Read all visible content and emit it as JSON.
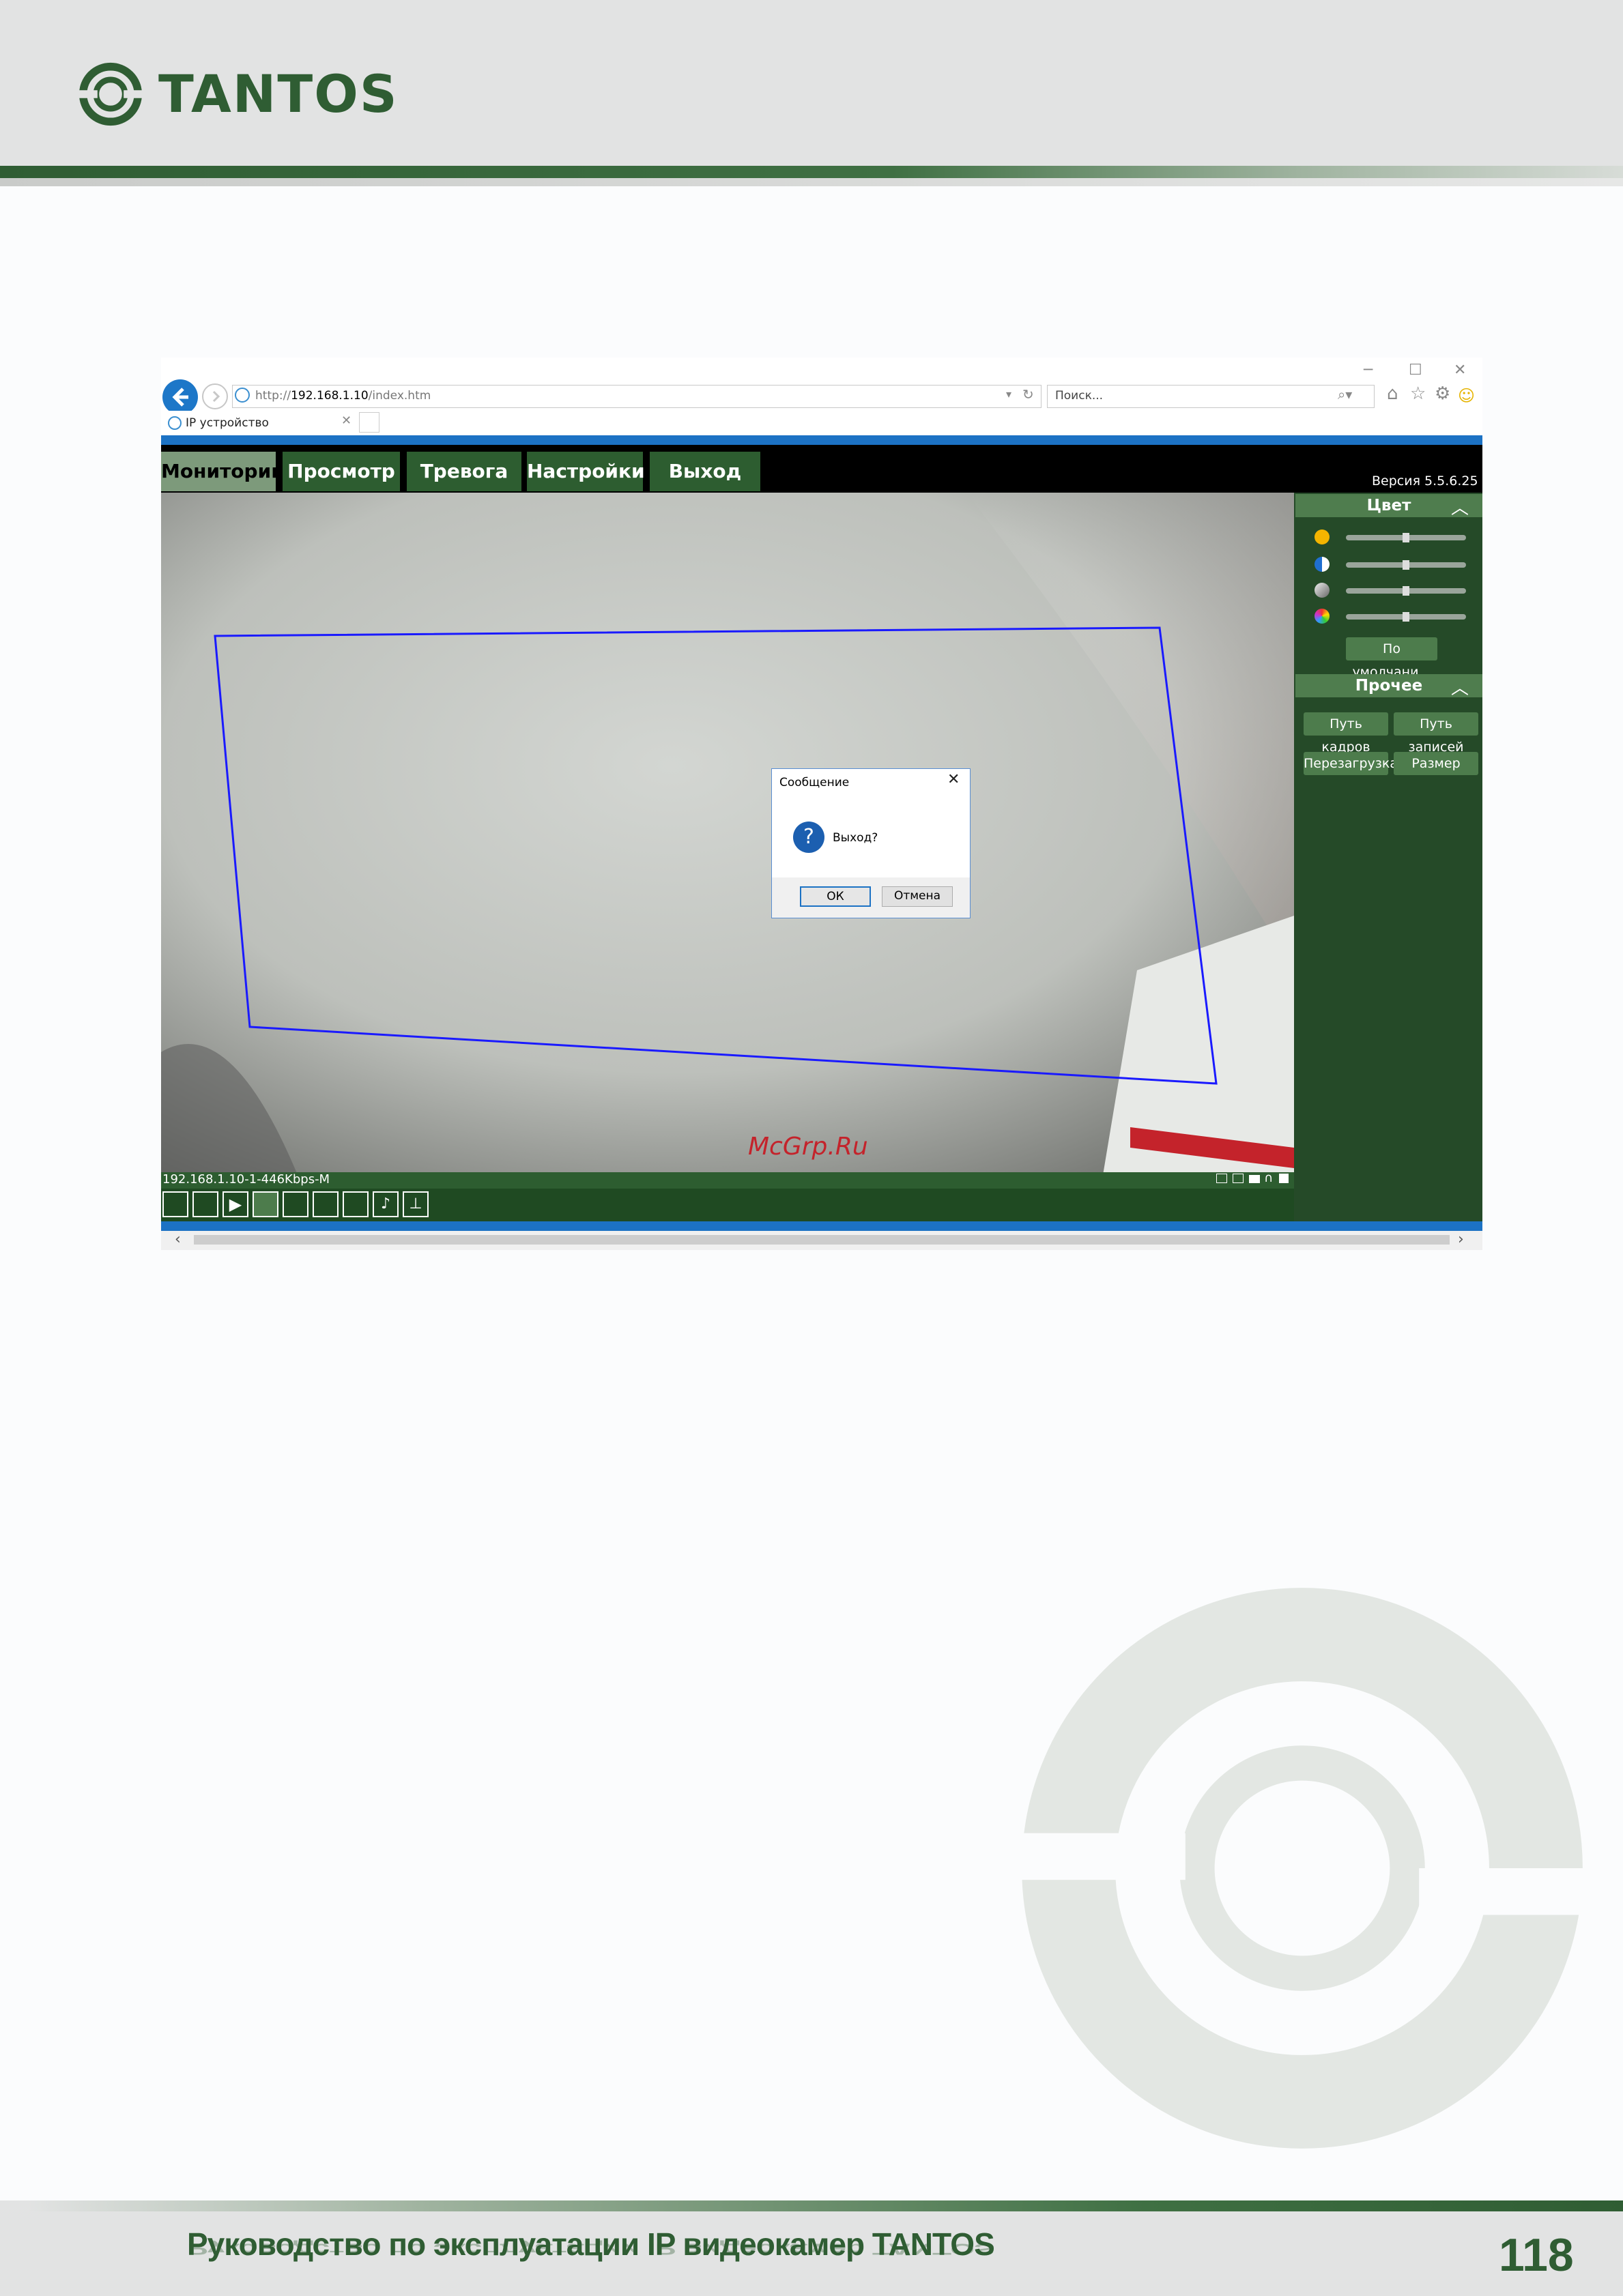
{
  "page": {
    "brand": "TANTOS",
    "footer_title": "Руководство по эксплуатации IP видеокамер TANTOS",
    "page_number": "118"
  },
  "browser": {
    "url_prefix": "http://",
    "url_host": "192.168.1.10",
    "url_path": "/index.htm",
    "search_placeholder": "Поиск...",
    "tab_title": "IP устройство"
  },
  "app": {
    "nav": [
      "Мониторинг",
      "Просмотр",
      "Тревога",
      "Настройки",
      "Выход"
    ],
    "active_nav": "Мониторинг",
    "version": "Версия 5.5.6.25",
    "stream_info": "192.168.1.10-1-446Kbps-M",
    "watermark": "McGrp.Ru",
    "color_panel": {
      "title": "Цвет",
      "sliders": [
        {
          "icon": "brightness-icon",
          "level": 0.5
        },
        {
          "icon": "contrast-icon",
          "level": 0.5
        },
        {
          "icon": "saturation-icon",
          "level": 0.5
        },
        {
          "icon": "hue-icon",
          "level": 0.5
        }
      ],
      "default_button": "По умолчани..."
    },
    "other_panel": {
      "title": "Прочее",
      "buttons": [
        "Путь кадров",
        "Путь записей",
        "Перезагрузка",
        "Размер"
      ]
    }
  },
  "dialog": {
    "title": "Сообщение",
    "message": "Выход?",
    "ok": "ОК",
    "cancel": "Отмена"
  },
  "colors": {
    "brand_green": "#2f5d33",
    "ie_blue": "#1c72c4",
    "motion_zone": "#1a1aff"
  }
}
